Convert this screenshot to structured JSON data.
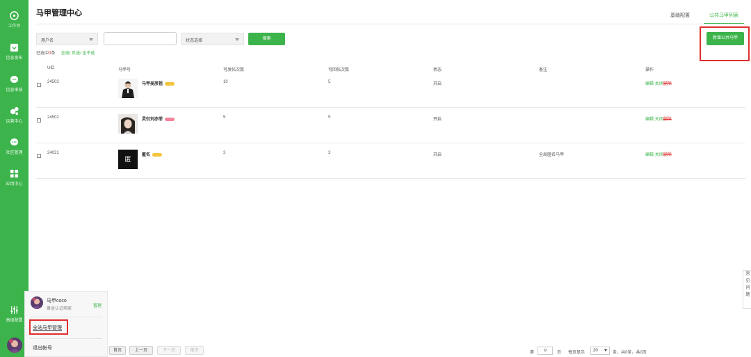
{
  "sidebar": {
    "items": [
      {
        "label": "工作台",
        "icon": "dashboard-icon"
      },
      {
        "label": "信息发布",
        "icon": "publish-icon"
      },
      {
        "label": "信息审核",
        "icon": "review-icon"
      },
      {
        "label": "运营中心",
        "icon": "operations-icon"
      },
      {
        "label": "社区管理",
        "icon": "community-icon"
      },
      {
        "label": "应用中心",
        "icon": "apps-icon"
      },
      {
        "label": "高级配置",
        "icon": "settings-sliders-icon"
      }
    ]
  },
  "header": {
    "title": "马甲管理中心",
    "tabs": [
      {
        "label": "基础配置",
        "active": false
      },
      {
        "label": "公共马甲列表",
        "active": true
      }
    ]
  },
  "filters": {
    "user_select": "用户名",
    "search_value": "",
    "status_select": "状态选择",
    "search_button": "搜索",
    "new_button": "新增公共马甲"
  },
  "selection": {
    "prefix": "已选中",
    "count": "0",
    "suffix": "条",
    "select_all": "全选/",
    "invert": "反选/",
    "none": "全不选"
  },
  "table": {
    "headers": [
      "UID",
      "马甲号",
      "可发帖次数",
      "可回帖次数",
      "状态",
      "备注",
      "操作"
    ],
    "rows": [
      {
        "uid": "24503",
        "name": "马甲吴彦祖",
        "post": "10",
        "reply": "5",
        "status": "开启",
        "note": "",
        "badge": "yellow"
      },
      {
        "uid": "24502",
        "name": "灵衍刘亦菲",
        "post": "5",
        "reply": "5",
        "status": "开启",
        "note": "",
        "badge": "pink"
      },
      {
        "uid": "24031",
        "name": "匿名",
        "post": "3",
        "reply": "3",
        "status": "开启",
        "note": "全局匿名马甲",
        "badge": "yellow",
        "avatar_text": "匿"
      }
    ],
    "ops": {
      "edit": "编辑",
      "close": "关闭",
      "delete": "删除"
    }
  },
  "user_popup": {
    "name": "马甲coco",
    "subtitle": "黄金认证商家",
    "manage": "管理",
    "site_manage": "全站马甲管理",
    "logout": "退出帐号"
  },
  "pagination": {
    "first": "首页",
    "prev": "上一页",
    "next": "下一页",
    "last": "尾页",
    "page_prefix": "第",
    "page_value": "0",
    "page_suffix": "页",
    "per_page_label": "每页显示",
    "per_page_value": "20",
    "summary": "条，共0条，共0页"
  },
  "side_tab": [
    "常",
    "见",
    "问",
    "题"
  ],
  "colors": {
    "brand": "#3cb44b",
    "danger": "#e02d2d"
  }
}
